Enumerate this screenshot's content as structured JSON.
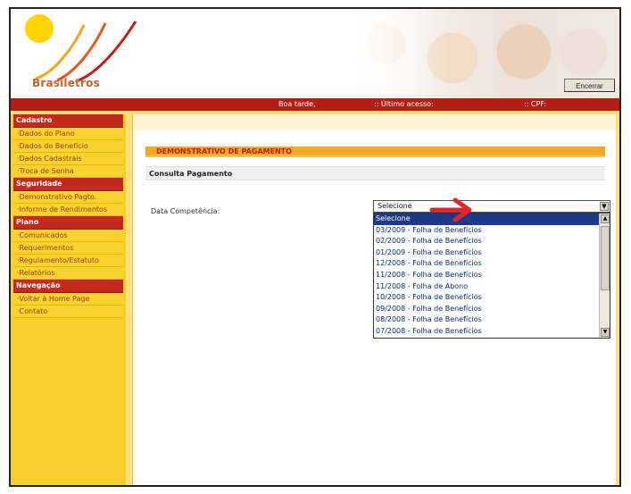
{
  "header": {
    "brand": "Brasiletros",
    "logout_label": "Encerrar"
  },
  "topbar": {
    "greeting": "Boa tarde,",
    "last_access": ":: Último acesso:",
    "cpf": ":: CPF:"
  },
  "sidebar": {
    "sections": [
      {
        "title": "Cadastro",
        "items": [
          "Dados do Plano",
          "Dados do Benefício",
          "Dados Cadastrais",
          "Troca de Senha"
        ]
      },
      {
        "title": "Seguridade",
        "items": [
          "Demonstrativo Pagto.",
          "Informe de Rendimentos"
        ]
      },
      {
        "title": "Plano",
        "items": [
          "Comunicados",
          "Requerimentos",
          "Regulamento/Estatuto",
          "Relatórios"
        ]
      },
      {
        "title": "Navegação",
        "items": [
          "Voltar à Home Page",
          "Contato"
        ]
      }
    ]
  },
  "main": {
    "section_title": "DEMONSTRATIVO DE PAGAMENTO",
    "subsection_title": "Consulta Pagamento",
    "field_label": "Data Competência:",
    "select": {
      "value": "Selecione",
      "options": [
        "Selecione",
        "03/2009 - Folha de Benefícios",
        "02/2009 - Folha de Benefícios",
        "01/2009 - Folha de Benefícios",
        "12/2008 - Folha de Benefícios",
        "11/2008 - Folha de Benefícios",
        "11/2008 - Folha de Abono",
        "10/2008 - Folha de Benefícios",
        "09/2008 - Folha de Benefícios",
        "08/2008 - Folha de Benefícios",
        "07/2008 - Folha de Benefícios"
      ]
    }
  },
  "colors": {
    "brand_red": "#b21e14",
    "sidebar_yellow": "#f8cf2c",
    "header_orange": "#f7a925",
    "annotation_arrow": "#e3262b"
  },
  "icons": [
    "logo-swoosh-icon",
    "dropdown-arrow-icon",
    "scroll-up-icon",
    "scroll-down-icon",
    "annotation-arrow-icon"
  ]
}
